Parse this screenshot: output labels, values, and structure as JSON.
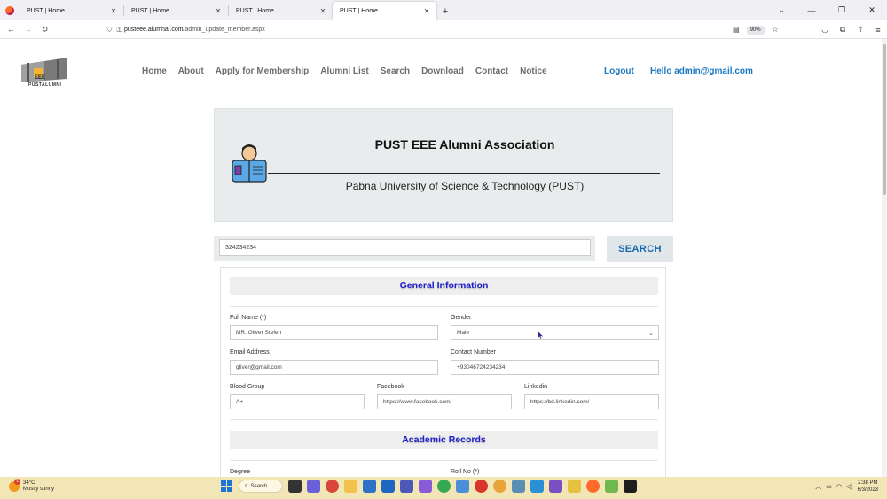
{
  "browser": {
    "tabs": [
      {
        "title": "PUST | Home",
        "active": false
      },
      {
        "title": "PUST | Home",
        "active": false
      },
      {
        "title": "PUST | Home",
        "active": false
      },
      {
        "title": "PUST | Home",
        "active": true
      }
    ],
    "url_host": "pusteee.alumnai.com",
    "url_path": "/admin_update_member.aspx",
    "zoom": "90%"
  },
  "site": {
    "logo_text": "PUSTALUMNI",
    "logo_badge": "EEE",
    "menu": [
      "Home",
      "About",
      "Apply for Membership",
      "Alumni List",
      "Search",
      "Download",
      "Contact",
      "Notice"
    ],
    "logout": "Logout",
    "hello": "Hello admin@gmail.com"
  },
  "banner": {
    "title": "PUST EEE Alumni Association",
    "subtitle": "Pabna University of Science & Technology (PUST)"
  },
  "search": {
    "value": "324234234",
    "button": "SEARCH"
  },
  "form": {
    "general_heading": "General Information",
    "academic_heading": "Academic Records",
    "full_name_label": "Full Name (*)",
    "full_name_value": "MR. Gliver Stefen",
    "gender_label": "Gender",
    "gender_value": "Male",
    "email_label": "Email Address",
    "email_value": "gliver@gmail.com",
    "contact_label": "Contact Number",
    "contact_value": "+93046724234234",
    "blood_label": "Blood Group",
    "blood_value": "A+",
    "facebook_label": "Facebook",
    "facebook_value": "https://www.facebook.com/",
    "linkedin_label": "Linkedin",
    "linkedin_value": "https://bd.linkedin.com/",
    "degree_label": "Degree",
    "roll_label": "Roll No (*)"
  },
  "taskbar": {
    "temp": "34°C",
    "weather": "Mostly sunny",
    "weather_badge": "1",
    "search_label": "Search",
    "time": "2:38 PM",
    "date": "6/3/2023"
  },
  "colors": {
    "accent_blue": "#1a78c2",
    "section_heading": "#1f1fcf",
    "taskbar": "#f3e6b6"
  }
}
